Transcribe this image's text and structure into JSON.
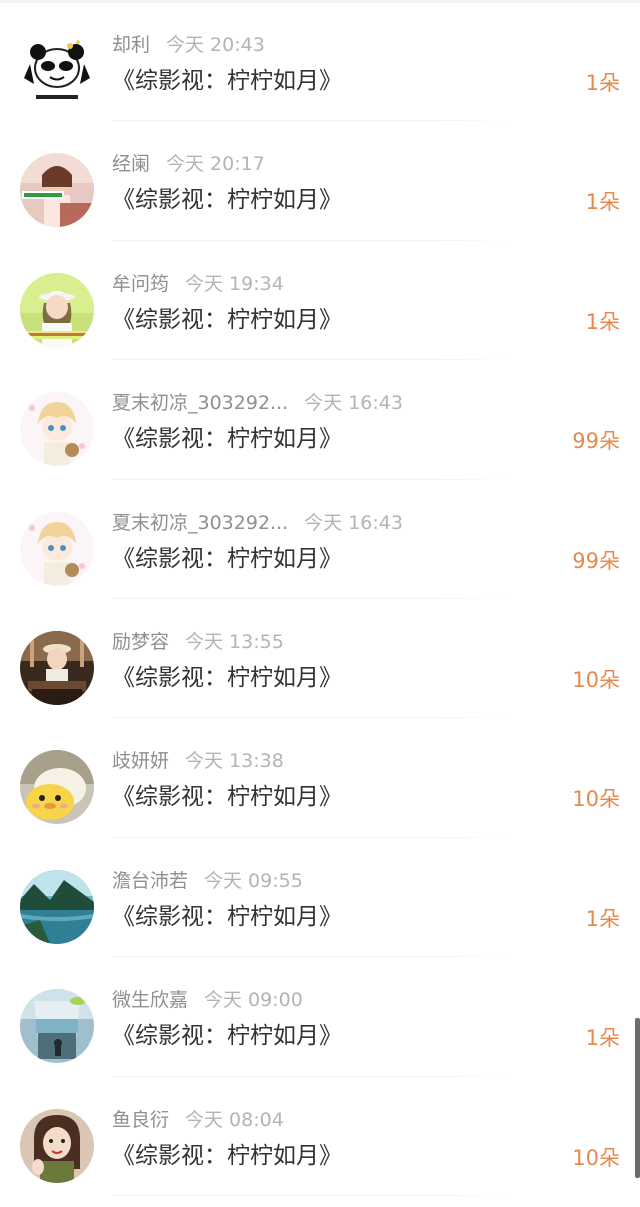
{
  "colors": {
    "accent": "#e8884a",
    "name_text": "#8f8f8f",
    "time_text": "#b4b4b4",
    "title_text": "#333333"
  },
  "items": [
    {
      "name": "却利",
      "time": "今天 20:43",
      "title": "《综影视：柠柠如月》",
      "count": "1朵",
      "avatar": "panda-meme-avatar"
    },
    {
      "name": "经阑",
      "time": "今天 20:17",
      "title": "《综影视：柠柠如月》",
      "count": "1朵",
      "avatar": "girl-photo-avatar"
    },
    {
      "name": "牟问筠",
      "time": "今天 19:34",
      "title": "《综影视：柠柠如月》",
      "count": "1朵",
      "avatar": "girl-hat-avatar"
    },
    {
      "name": "夏末初凉_303292...",
      "time": "今天 16:43",
      "title": "《综影视：柠柠如月》",
      "count": "99朵",
      "avatar": "anime-boy-avatar"
    },
    {
      "name": "夏末初凉_303292...",
      "time": "今天 16:43",
      "title": "《综影视：柠柠如月》",
      "count": "99朵",
      "avatar": "anime-boy-avatar"
    },
    {
      "name": "励梦容",
      "time": "今天 13:55",
      "title": "《综影视：柠柠如月》",
      "count": "10朵",
      "avatar": "child-photo-avatar"
    },
    {
      "name": "歧妍妍",
      "time": "今天 13:38",
      "title": "《综影视：柠柠如月》",
      "count": "10朵",
      "avatar": "duck-avatar"
    },
    {
      "name": "澹台沛若",
      "time": "今天 09:55",
      "title": "《综影视：柠柠如月》",
      "count": "1朵",
      "avatar": "landscape-avatar"
    },
    {
      "name": "微生欣嘉",
      "time": "今天 09:00",
      "title": "《综影视：柠柠如月》",
      "count": "1朵",
      "avatar": "glass-avatar"
    },
    {
      "name": "鱼良衍",
      "time": "今天 08:04",
      "title": "《综影视：柠柠如月》",
      "count": "10朵",
      "avatar": "girl-selfie-avatar"
    }
  ]
}
